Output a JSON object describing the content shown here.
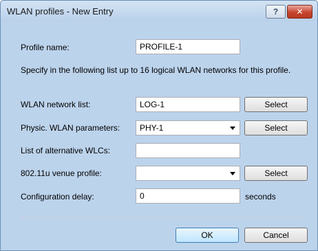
{
  "window": {
    "title": "WLAN profiles - New Entry",
    "help_glyph": "?",
    "close_glyph": "✕"
  },
  "form": {
    "profile_name_label": "Profile name:",
    "profile_name_value": "PROFILE-1",
    "info_text": "Specify in the following list up to 16 logical WLAN networks for this profile.",
    "network_list_label": "WLAN network list:",
    "network_list_value": "LOG-1",
    "physic_label": "Physic. WLAN parameters:",
    "physic_value": "PHY-1",
    "alt_wlc_label": "List of alternative WLCs:",
    "alt_wlc_value": "",
    "venue_label": "802.11u venue profile:",
    "venue_value": "",
    "delay_label": "Configuration delay:",
    "delay_value": "0",
    "delay_unit": "seconds",
    "select_label": "Select"
  },
  "footer": {
    "ok_label": "OK",
    "cancel_label": "Cancel"
  }
}
